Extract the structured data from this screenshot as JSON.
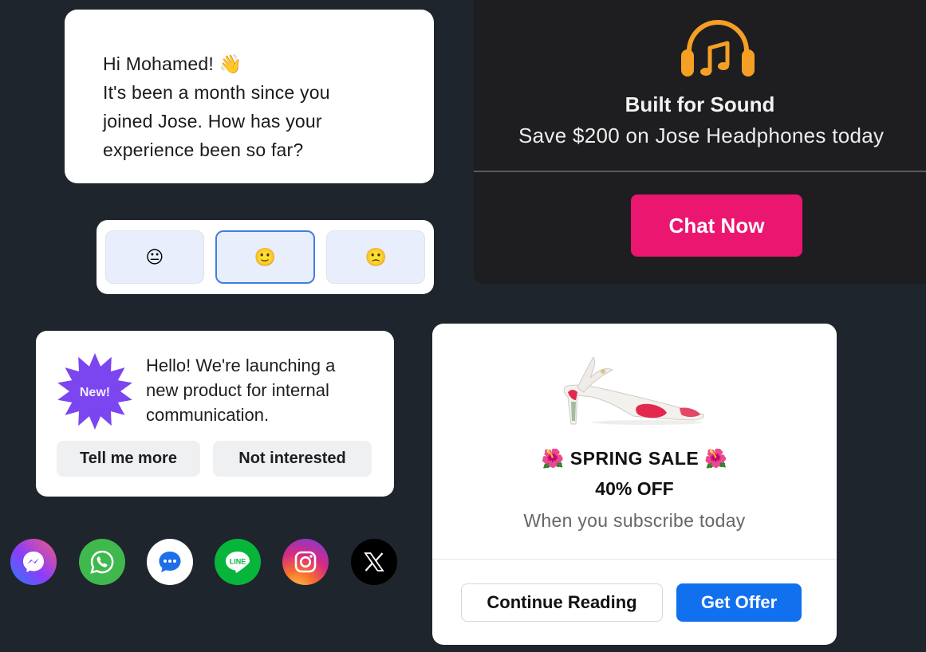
{
  "greeting": {
    "line1": "Hi Mohamed! 👋",
    "line2": "It's been a month since you",
    "line3": "joined Jose. How has your",
    "line4": "experience been so far?"
  },
  "rating": {
    "options": [
      {
        "emoji": "😐",
        "label": "neutral"
      },
      {
        "emoji": "🙂",
        "label": "happy",
        "selected": true
      },
      {
        "emoji": "🙁",
        "label": "sad"
      }
    ]
  },
  "promo": {
    "icon": "headphones-music-icon",
    "title": "Built for Sound",
    "subtitle": "Save $200 on Jose Headphones today",
    "cta": "Chat Now",
    "colors": {
      "icon": "#f5a024",
      "cta": "#ea166f"
    }
  },
  "announcement": {
    "badge": "New!",
    "line1": "Hello! We're launching a",
    "line2": "new product for internal",
    "line3": "communication.",
    "primary": "Tell me more",
    "secondary": "Not interested",
    "colors": {
      "badge": "#7b45f0"
    }
  },
  "social": [
    {
      "name": "messenger-icon"
    },
    {
      "name": "whatsapp-icon"
    },
    {
      "name": "sms-chat-icon"
    },
    {
      "name": "line-icon",
      "label": "LINE"
    },
    {
      "name": "instagram-icon"
    },
    {
      "name": "x-icon"
    }
  ],
  "sale": {
    "title": "🌺 SPRING SALE 🌺",
    "discount": "40% OFF",
    "subtitle": "When you subscribe today",
    "secondary": "Continue Reading",
    "primary": "Get Offer",
    "colors": {
      "primary": "#1070ee"
    }
  }
}
